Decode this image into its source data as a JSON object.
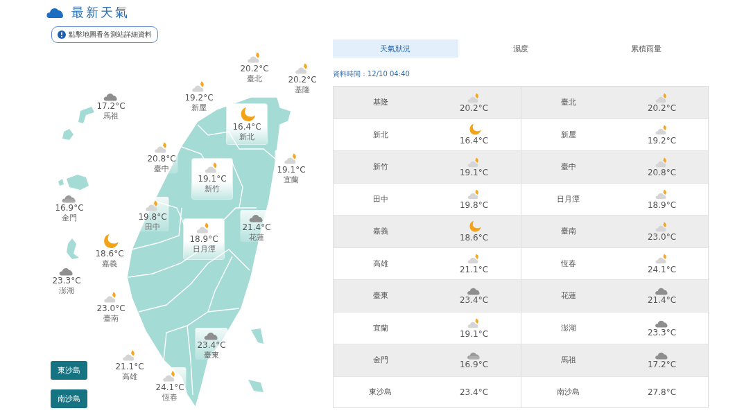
{
  "title": "最新天氣",
  "notice": "點擊地圖看各測站詳細資料",
  "stations": [
    {
      "name": "臺北",
      "temp": "20.2°C",
      "kind": "cloudy-night",
      "boxed": false
    },
    {
      "name": "基隆",
      "temp": "20.2°C",
      "kind": "cloudy-night",
      "boxed": false
    },
    {
      "name": "新屋",
      "temp": "19.2°C",
      "kind": "cloudy-night",
      "boxed": false
    },
    {
      "name": "馬祖",
      "temp": "17.2°C",
      "kind": "cloudy",
      "boxed": false
    },
    {
      "name": "新北",
      "temp": "16.4°C",
      "kind": "clear-night",
      "boxed": true
    },
    {
      "name": "臺中",
      "temp": "20.8°C",
      "kind": "cloudy-night",
      "boxed": false
    },
    {
      "name": "宜蘭",
      "temp": "19.1°C",
      "kind": "cloudy-night",
      "boxed": false
    },
    {
      "name": "新竹",
      "temp": "19.1°C",
      "kind": "cloudy-night",
      "boxed": true
    },
    {
      "name": "金門",
      "temp": "16.9°C",
      "kind": "overcast",
      "boxed": false
    },
    {
      "name": "田中",
      "temp": "19.8°C",
      "kind": "cloudy-night",
      "boxed": false
    },
    {
      "name": "日月潭",
      "temp": "18.9°C",
      "kind": "cloudy-night",
      "boxed": true
    },
    {
      "name": "花蓮",
      "temp": "21.4°C",
      "kind": "cloudy",
      "boxed": false
    },
    {
      "name": "嘉義",
      "temp": "18.6°C",
      "kind": "clear-night",
      "boxed": false
    },
    {
      "name": "澎湖",
      "temp": "23.3°C",
      "kind": "cloudy",
      "boxed": false
    },
    {
      "name": "臺南",
      "temp": "23.0°C",
      "kind": "cloudy-night",
      "boxed": false
    },
    {
      "name": "臺東",
      "temp": "23.4°C",
      "kind": "cloudy",
      "boxed": false
    },
    {
      "name": "高雄",
      "temp": "21.1°C",
      "kind": "cloudy-night",
      "boxed": false
    },
    {
      "name": "恆春",
      "temp": "24.1°C",
      "kind": "cloudy-night",
      "boxed": false
    }
  ],
  "island_buttons": [
    "東沙島",
    "南沙島"
  ],
  "tabs": [
    {
      "label": "天氣狀況",
      "selected": true
    },
    {
      "label": "濕度",
      "selected": false
    },
    {
      "label": "累積雨量",
      "selected": false
    }
  ],
  "data_time": "資料時間：12/10 04:40",
  "table": {
    "rows": [
      {
        "cells": [
          {
            "name": "基隆",
            "temp": "20.2°C",
            "kind": "cloudy-night"
          },
          {
            "name": "臺北",
            "temp": "20.2°C",
            "kind": "cloudy-night"
          }
        ]
      },
      {
        "cells": [
          {
            "name": "新北",
            "temp": "16.4°C",
            "kind": "clear-night"
          },
          {
            "name": "新屋",
            "temp": "19.2°C",
            "kind": "cloudy-night"
          }
        ]
      },
      {
        "cells": [
          {
            "name": "新竹",
            "temp": "19.1°C",
            "kind": "cloudy-night"
          },
          {
            "name": "臺中",
            "temp": "20.8°C",
            "kind": "cloudy-night"
          }
        ]
      },
      {
        "cells": [
          {
            "name": "田中",
            "temp": "19.8°C",
            "kind": "cloudy-night"
          },
          {
            "name": "日月潭",
            "temp": "18.9°C",
            "kind": "cloudy-night"
          }
        ]
      },
      {
        "cells": [
          {
            "name": "嘉義",
            "temp": "18.6°C",
            "kind": "clear-night"
          },
          {
            "name": "臺南",
            "temp": "23.0°C",
            "kind": "cloudy-night"
          }
        ]
      },
      {
        "cells": [
          {
            "name": "高雄",
            "temp": "21.1°C",
            "kind": "cloudy-night"
          },
          {
            "name": "恆春",
            "temp": "24.1°C",
            "kind": "cloudy-night"
          }
        ]
      },
      {
        "cells": [
          {
            "name": "臺東",
            "temp": "23.4°C",
            "kind": "cloudy"
          },
          {
            "name": "花蓮",
            "temp": "21.4°C",
            "kind": "cloudy"
          }
        ]
      },
      {
        "cells": [
          {
            "name": "宜蘭",
            "temp": "19.1°C",
            "kind": "cloudy-night"
          },
          {
            "name": "澎湖",
            "temp": "23.3°C",
            "kind": "cloudy"
          }
        ]
      },
      {
        "cells": [
          {
            "name": "金門",
            "temp": "16.9°C",
            "kind": "overcast"
          },
          {
            "name": "馬祖",
            "temp": "17.2°C",
            "kind": "cloudy"
          }
        ]
      },
      {
        "cells": [
          {
            "name": "東沙島",
            "temp": "23.4°C"
          },
          {
            "name": "南沙島",
            "temp": "27.8°C"
          }
        ]
      }
    ]
  }
}
